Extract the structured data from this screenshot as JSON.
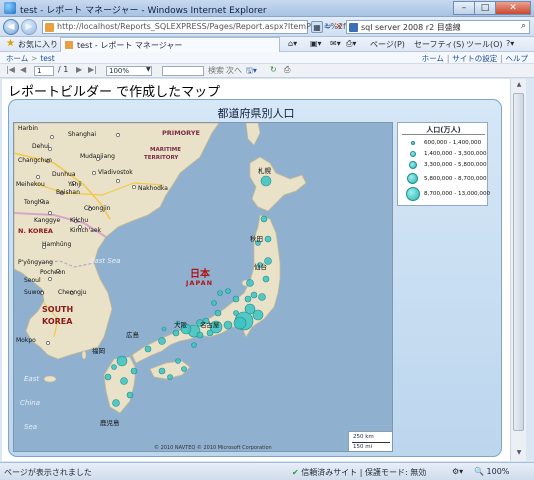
{
  "window": {
    "title": "test - レポート マネージャー - Windows Internet Explorer"
  },
  "address_bar": {
    "url": "http://localhost/Reports_SQLEXPRESS/Pages/Report.aspx?ItemPath=%2ftest",
    "search_text": "sql server 2008 r2 目盛線"
  },
  "favorites": {
    "label": "お気に入り",
    "tab_label": "test - レポート マネージャー",
    "page_menu": "ページ(P)",
    "safety_menu": "セーフティ(S)",
    "tools_menu": "ツール(O)"
  },
  "breadcrumb": {
    "home": "ホーム",
    "sep": ">",
    "current": "test",
    "right_home": "ホーム",
    "site_settings": "サイトの設定",
    "help": "ヘルプ"
  },
  "report_toolbar": {
    "page_current": "1",
    "page_total": "/ 1",
    "zoom": "100%",
    "find": "検索",
    "next": "次へ"
  },
  "report": {
    "title": "レポートビルダー で作成したマップ",
    "map_title": "都道府県別人口"
  },
  "legend": {
    "title": "人口(万人)",
    "items": [
      {
        "label": "600,000 - 1,400,000"
      },
      {
        "label": "1,400,000 - 3,300,000"
      },
      {
        "label": "3,300,000 - 5,800,000"
      },
      {
        "label": "5,800,000 - 8,700,000"
      },
      {
        "label": "8,700,000 - 13,000,000"
      }
    ]
  },
  "map_labels": {
    "harbin": "Harbin",
    "shanghai": "Shanghai",
    "primorye": "PRIMORYE",
    "dehui": "Dehui",
    "mudanjiang": "Mudanjiang",
    "changchun": "Changchun",
    "maritime1": "MARITIME",
    "maritime2": "TERRITORY",
    "dunhua": "Dunhua",
    "vladivostok": "Vladivostok",
    "meihekou": "Meihekou",
    "yanji": "Yanji",
    "nakhodka": "Nakhodka",
    "baishan": "Baishan",
    "tonghua": "Tonghua",
    "chongjin": "Chongjin",
    "kanggye": "Kanggye",
    "kilchu": "Kilchu",
    "nkorea": "N. KOREA",
    "kimchaek": "Kimch'aek",
    "hamhung": "Hamhŭng",
    "eastsea": "East Sea",
    "pyongyang": "P'yŏngyang",
    "pocheon": "Pocheon",
    "seoul": "Seoul",
    "suwon": "Suwon",
    "cheongju": "Cheongju",
    "skorea1": "SOUTH",
    "skorea2": "KOREA",
    "mokpo": "Mokpo",
    "eastchina1": "East",
    "eastchina2": "China",
    "eastchina3": "Sea",
    "sapporo": "札幌",
    "akita": "秋田",
    "sendai": "仙台",
    "nihon_jp": "日本",
    "nihon_en": "JAPAN",
    "osaka": "大阪",
    "nagoya": "名古屋",
    "hiroshima": "広島",
    "fukuoka": "福岡",
    "kagoshima": "鹿児島"
  },
  "scale": {
    "km": "250 km",
    "mi": "150 mi"
  },
  "copyright": "© 2010 NAVTEQ  © 2010 Microsoft Corporation",
  "statusbar": {
    "left": "ページが表示されました",
    "trusted": "信頼済みサイト | 保護モード: 無効",
    "zoom": "100%"
  }
}
